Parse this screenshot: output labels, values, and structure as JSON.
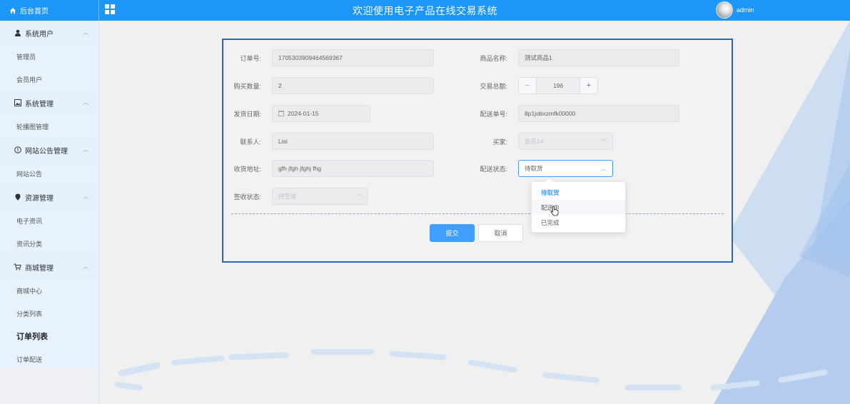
{
  "header": {
    "home_label": "后台首页",
    "title": "欢迎使用电子产品在线交易系统",
    "username": "admin"
  },
  "sidebar": {
    "groups": [
      {
        "title": "系统用户",
        "icon": "user-icon",
        "items": [
          "管理员",
          "会员用户"
        ]
      },
      {
        "title": "系统管理",
        "icon": "image-icon",
        "items": [
          "轮播图管理"
        ]
      },
      {
        "title": "网站公告管理",
        "icon": "info-icon",
        "items": [
          "网站公告"
        ]
      },
      {
        "title": "资源管理",
        "icon": "location-icon",
        "items": [
          "电子资讯",
          "资讯分类"
        ]
      },
      {
        "title": "商城管理",
        "icon": "cart-icon",
        "items": [
          "商城中心",
          "分类列表",
          "订单列表",
          "订单配送"
        ]
      }
    ],
    "active_item": "订单列表"
  },
  "form": {
    "order_no": {
      "label": "订单号:",
      "value": "1705303909464569367"
    },
    "product_name": {
      "label": "商品名称:",
      "value": "测试商品1"
    },
    "quantity": {
      "label": "购买数量:",
      "value": "2"
    },
    "total": {
      "label": "交易总额:",
      "value": "196"
    },
    "ship_date": {
      "label": "发货日期:",
      "value": "2024-01-15"
    },
    "tracking_no": {
      "label": "配送单号:",
      "value": "8p1jobxzmfk00000"
    },
    "contact": {
      "label": "联系人:",
      "value": "Lisi"
    },
    "buyer": {
      "label": "买家:",
      "value": "会员14"
    },
    "address": {
      "label": "收货地址:",
      "value": "gfh jfgh jfghj fhg"
    },
    "delivery_status": {
      "label": "配送状态:",
      "value": "待取货",
      "options": [
        "待取货",
        "配送中",
        "已完成"
      ]
    },
    "sign_status": {
      "label": "签收状态:",
      "value": "待签收"
    },
    "submit_label": "提交",
    "cancel_label": "取消"
  },
  "colors": {
    "header_bg": "#1c96f7",
    "primary": "#409eff",
    "card_border": "#2d63b8",
    "sidebar_bg": "#f1f7fd"
  }
}
